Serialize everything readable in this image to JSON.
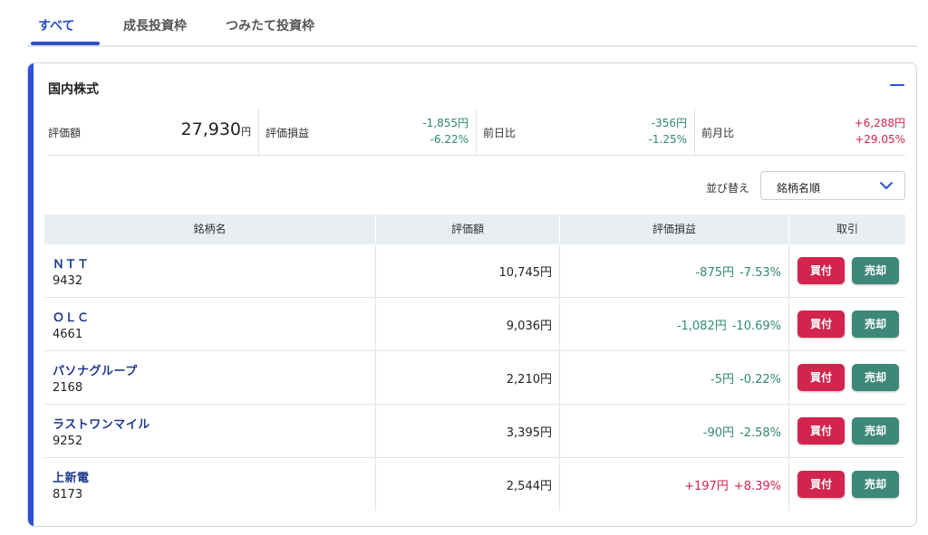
{
  "tabs": [
    {
      "label": "すべて",
      "active": true
    },
    {
      "label": "成長投資枠",
      "active": false
    },
    {
      "label": "つみたて投資枠",
      "active": false
    }
  ],
  "card": {
    "title": "国内株式",
    "collapse_icon": "minus-icon"
  },
  "summary": {
    "valuation": {
      "label": "評価額",
      "value": "27,930",
      "unit": "円"
    },
    "unrealized": {
      "label": "評価損益",
      "amount": "-1,855円",
      "percent": "-6.22%"
    },
    "day_change": {
      "label": "前日比",
      "amount": "-356円",
      "percent": "-1.25%"
    },
    "month_change": {
      "label": "前月比",
      "amount": "+6,288円",
      "percent": "+29.05%"
    }
  },
  "sort": {
    "label": "並び替え",
    "selected": "銘柄名順",
    "icon": "chevron-down-icon"
  },
  "table": {
    "headers": [
      "銘柄名",
      "評価額",
      "評価損益",
      "取引"
    ],
    "rows": [
      {
        "name": "ＮＴＴ",
        "code": "9432",
        "valuation": "10,745円",
        "pl_amount": "-875円",
        "pl_percent": "-7.53%",
        "buy": "買付",
        "sell": "売却"
      },
      {
        "name": "ＯＬＣ",
        "code": "4661",
        "valuation": "9,036円",
        "pl_amount": "-1,082円",
        "pl_percent": "-10.69%",
        "buy": "買付",
        "sell": "売却"
      },
      {
        "name": "パソナグループ",
        "code": "2168",
        "valuation": "2,210円",
        "pl_amount": "-5円",
        "pl_percent": "-0.22%",
        "buy": "買付",
        "sell": "売却"
      },
      {
        "name": "ラストワンマイル",
        "code": "9252",
        "valuation": "3,395円",
        "pl_amount": "-90円",
        "pl_percent": "-2.58%",
        "buy": "買付",
        "sell": "売却"
      },
      {
        "name": "上新電",
        "code": "8173",
        "valuation": "2,544円",
        "pl_amount": "+197円",
        "pl_percent": "+8.39%",
        "buy": "買付",
        "sell": "売却"
      }
    ]
  },
  "colors": {
    "accent": "#2f4fd6",
    "gain": "#d2244d",
    "loss": "#2f8a6a",
    "buy": "#d2244d",
    "sell": "#3d8878"
  }
}
